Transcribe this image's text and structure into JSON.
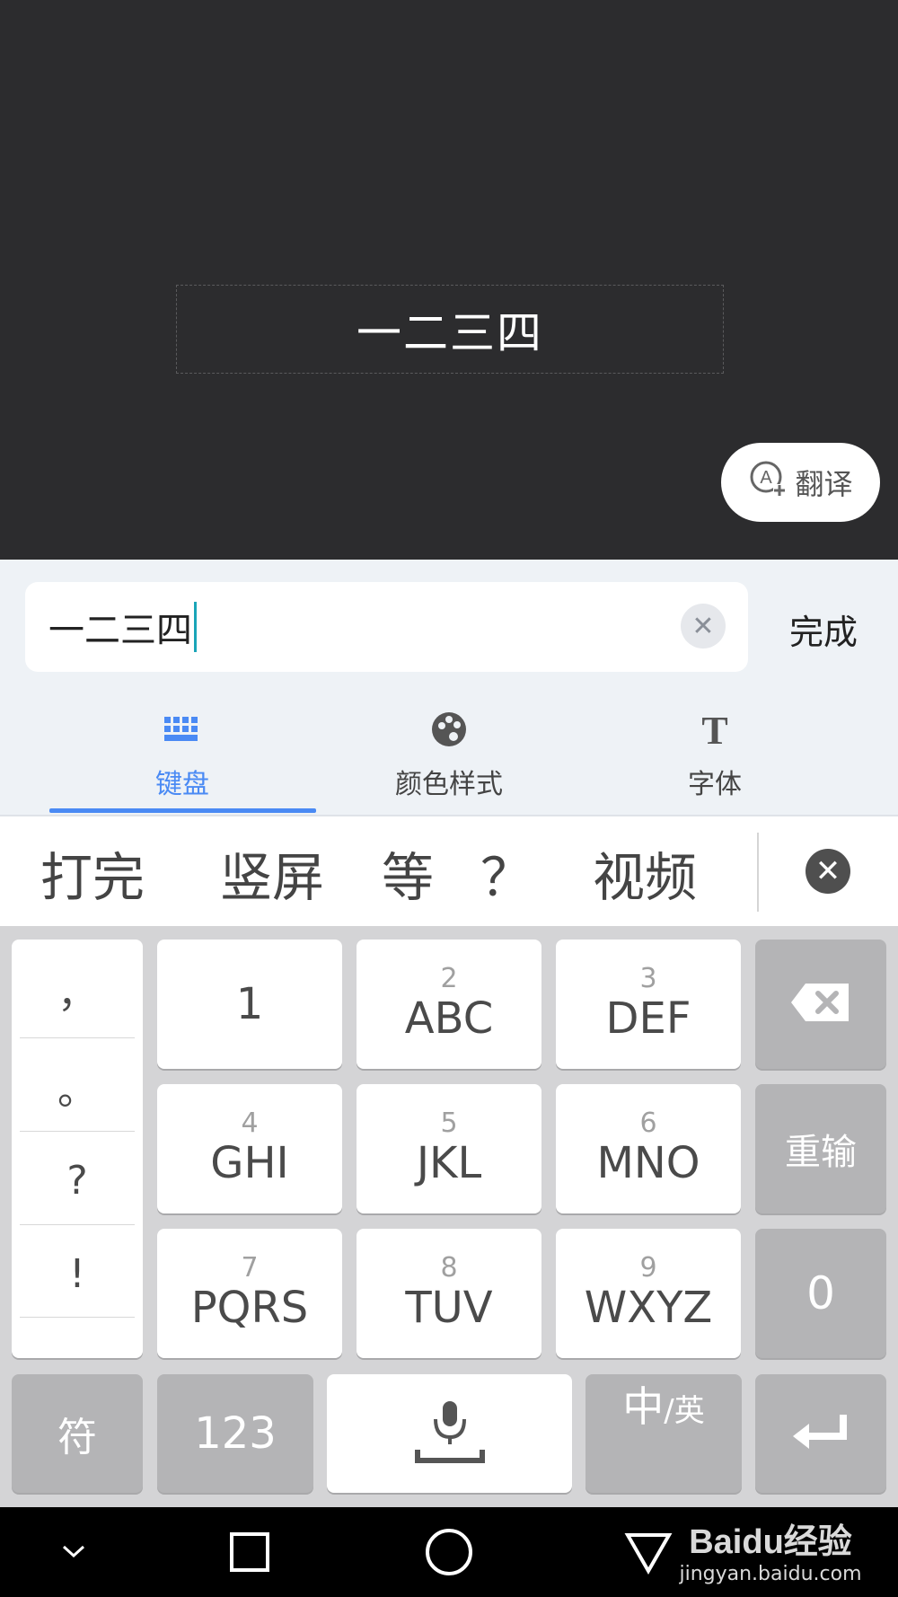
{
  "preview": {
    "text": "一二三四",
    "translate_label": "翻译"
  },
  "editor": {
    "input_value": "一二三四",
    "done_label": "完成",
    "tabs": [
      {
        "label": "键盘",
        "icon": "keyboard-icon",
        "active": true
      },
      {
        "label": "颜色样式",
        "icon": "palette-icon",
        "active": false
      },
      {
        "label": "字体",
        "icon": "font-icon",
        "active": false
      }
    ],
    "accent_color": "#4a8af4"
  },
  "candidates": [
    "打完",
    "竖屏",
    "等",
    "？",
    "视频"
  ],
  "keyboard": {
    "punctuation": [
      "，",
      "。",
      "?",
      "!"
    ],
    "rows": [
      [
        {
          "num": "",
          "letters": "1"
        },
        {
          "num": "2",
          "letters": "ABC"
        },
        {
          "num": "3",
          "letters": "DEF"
        }
      ],
      [
        {
          "num": "4",
          "letters": "GHI"
        },
        {
          "num": "5",
          "letters": "JKL"
        },
        {
          "num": "6",
          "letters": "MNO"
        }
      ],
      [
        {
          "num": "7",
          "letters": "PQRS"
        },
        {
          "num": "8",
          "letters": "TUV"
        },
        {
          "num": "9",
          "letters": "WXYZ"
        }
      ]
    ],
    "side_keys": {
      "delete": "backspace-icon",
      "reinput": "重输",
      "zero": "0"
    },
    "bottom_row": {
      "symbols": "符",
      "numeric": "123",
      "space": "microphone-space-icon",
      "lang_main": "中",
      "lang_sub": "/英",
      "enter": "enter-icon"
    }
  },
  "navbar": {
    "watermark_main": "Baidu经验",
    "watermark_sub": "jingyan.baidu.com"
  }
}
